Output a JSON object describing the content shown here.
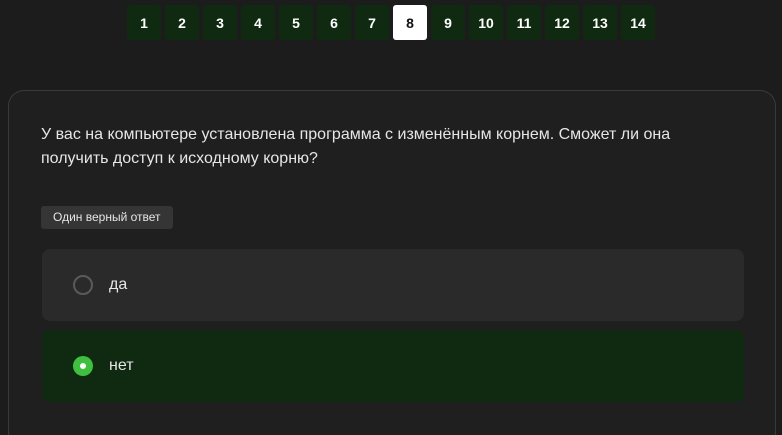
{
  "pager": {
    "pages": [
      "1",
      "2",
      "3",
      "4",
      "5",
      "6",
      "7",
      "8",
      "9",
      "10",
      "11",
      "12",
      "13",
      "14"
    ],
    "current": "8"
  },
  "question": {
    "text": "У вас на компьютере установлена программа с изменённым корнем. Сможет ли она получить доступ к исходному корню?",
    "badge": "Один верный ответ",
    "options": [
      {
        "label": "да",
        "selected": false
      },
      {
        "label": "нет",
        "selected": true
      }
    ]
  }
}
